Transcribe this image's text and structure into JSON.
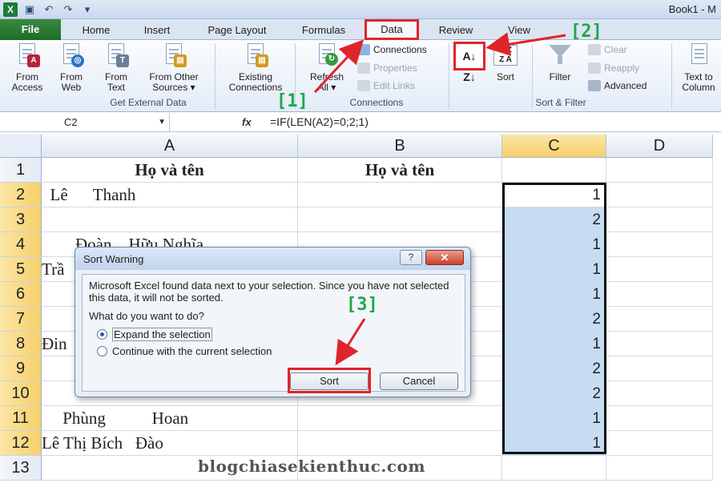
{
  "window": {
    "title": "Book1 - M"
  },
  "tabs": {
    "file": "File",
    "home": "Home",
    "insert": "Insert",
    "page_layout": "Page Layout",
    "formulas": "Formulas",
    "data": "Data",
    "review": "Review",
    "view": "View"
  },
  "ribbon": {
    "external": {
      "from_access": [
        "From",
        "Access"
      ],
      "from_web": [
        "From",
        "Web"
      ],
      "from_text": [
        "From",
        "Text"
      ],
      "from_other": [
        "From Other",
        "Sources ▾"
      ],
      "label": "Get External Data"
    },
    "connections": {
      "existing": [
        "Existing",
        "Connections"
      ],
      "refresh": [
        "Refresh",
        "All ▾"
      ],
      "connections": "Connections",
      "properties": "Properties",
      "edit_links": "Edit Links",
      "label": "Connections"
    },
    "sort_filter": {
      "sort": "Sort",
      "filter": "Filter",
      "clear": "Clear",
      "reapply": "Reapply",
      "advanced": "Advanced",
      "label": "Sort & Filter"
    },
    "tools": {
      "text_to": [
        "Text to",
        "Column"
      ]
    }
  },
  "formula_bar": {
    "name_box": "C2",
    "fx": "fx",
    "formula": "=IF(LEN(A2)=0;2;1)"
  },
  "grid": {
    "columns": [
      "A",
      "B",
      "C",
      "D"
    ],
    "rows": [
      "1",
      "2",
      "3",
      "4",
      "5",
      "6",
      "7",
      "8",
      "9",
      "10",
      "11",
      "12",
      "13"
    ],
    "header_a": "Họ và tên",
    "header_b": "Họ và tên",
    "col_a": [
      "  Lê      Thanh",
      "",
      "        Đoàn    Hữu Nghĩa",
      "Trầ",
      "",
      "",
      "Đin",
      "",
      "",
      "     Phùng           Hoan",
      "Lê Thị Bích   Đào"
    ],
    "col_c": [
      "1",
      "2",
      "1",
      "1",
      "1",
      "2",
      "1",
      "2",
      "2",
      "1",
      "1"
    ]
  },
  "dialog": {
    "title": "Sort Warning",
    "help": "?",
    "close": "✕",
    "message": "Microsoft Excel found data next to your selection.  Since you have not selected this data, it will not be sorted.",
    "question": "What do you want to do?",
    "option_expand": "Expand the selection",
    "option_continue": "Continue with the current selection",
    "sort_button": "Sort",
    "cancel_button": "Cancel"
  },
  "annotations": {
    "step1": "[1]",
    "step2": "[2]",
    "step3": "[3]"
  },
  "watermark": "blogchiasekienthuc.com",
  "colors": {
    "highlight_red": "#e0242b",
    "annotation_green": "#1fa84a",
    "selection_blue": "#c5dcf3",
    "file_tab": "#1e6b2a"
  }
}
